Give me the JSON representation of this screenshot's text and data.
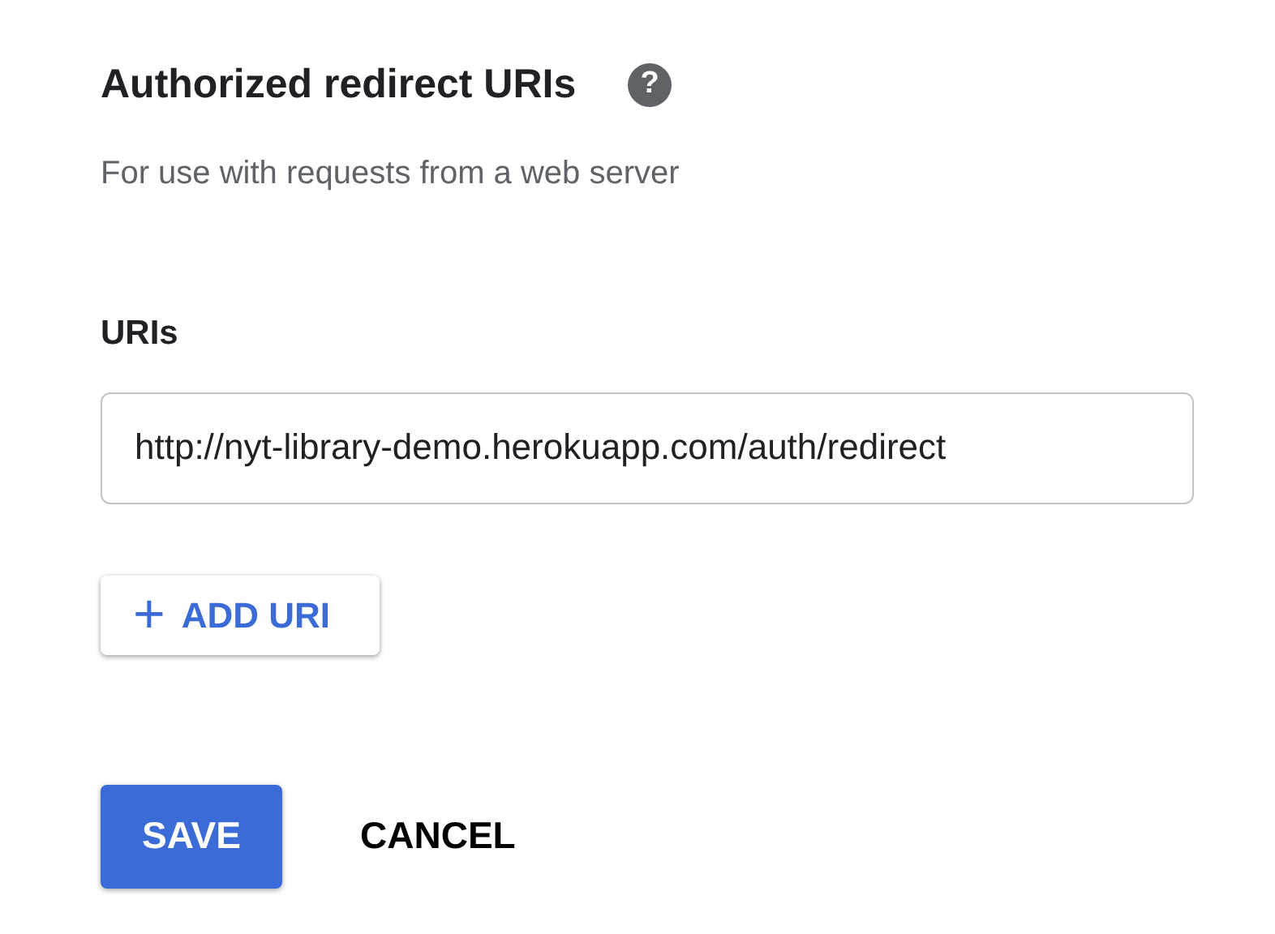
{
  "section": {
    "title": "Authorized redirect URIs",
    "help_icon": "?",
    "subtitle": "For use with requests from a web server"
  },
  "uris": {
    "label": "URIs",
    "values": [
      "http://nyt-library-demo.herokuapp.com/auth/redirect"
    ]
  },
  "add_button": {
    "icon": "+",
    "label": "ADD URI"
  },
  "buttons": [
    {
      "label": "SAVE",
      "kind": "primary"
    },
    {
      "label": "CANCEL",
      "kind": "text"
    }
  ]
}
